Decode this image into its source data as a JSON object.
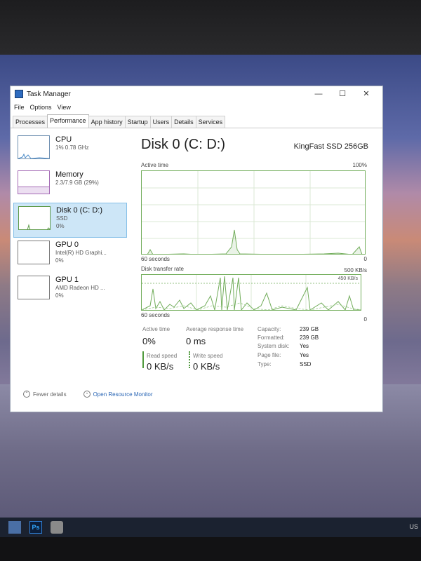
{
  "window": {
    "title": "Task Manager",
    "controls": {
      "minimize": "—",
      "maximize": "☐",
      "close": "✕"
    }
  },
  "menu": [
    "File",
    "Options",
    "View"
  ],
  "tabs": [
    "Processes",
    "Performance",
    "App history",
    "Startup",
    "Users",
    "Details",
    "Services"
  ],
  "active_tab": "Performance",
  "devices": [
    {
      "name": "CPU",
      "sub1": "1% 0.78 GHz",
      "sub2": ""
    },
    {
      "name": "Memory",
      "sub1": "2.3/7.9 GB (29%)",
      "sub2": ""
    },
    {
      "name": "Disk 0 (C: D:)",
      "sub1": "SSD",
      "sub2": "0%"
    },
    {
      "name": "GPU 0",
      "sub1": "Intel(R) HD Graphi...",
      "sub2": "0%"
    },
    {
      "name": "GPU 1",
      "sub1": "AMD Radeon HD ...",
      "sub2": "0%"
    }
  ],
  "selected_device": "Disk 0 (C: D:)",
  "detail": {
    "title": "Disk 0 (C: D:)",
    "model": "KingFast SSD 256GB",
    "graph1": {
      "label": "Active time",
      "max_label": "100%",
      "time_label": "60 seconds",
      "min_label": "0"
    },
    "graph2": {
      "label": "Disk transfer rate",
      "max_label": "500 KB/s",
      "ref_label": "450 KB/s",
      "time_label": "60 seconds",
      "min_label": "0"
    }
  },
  "stats": {
    "active_time_label": "Active time",
    "active_time_value": "0%",
    "avg_response_label": "Average response time",
    "avg_response_value": "0 ms",
    "read_speed_label": "Read speed",
    "read_speed_value": "0 KB/s",
    "write_speed_label": "Write speed",
    "write_speed_value": "0 KB/s"
  },
  "properties": [
    {
      "label": "Capacity:",
      "value": "239 GB"
    },
    {
      "label": "Formatted:",
      "value": "239 GB"
    },
    {
      "label": "System disk:",
      "value": "Yes"
    },
    {
      "label": "Page file:",
      "value": "Yes"
    },
    {
      "label": "Type:",
      "value": "SSD"
    }
  ],
  "footer": {
    "fewer_details": "Fewer details",
    "open_resource_monitor": "Open Resource Monitor"
  },
  "taskbar": {
    "ps_label": "Ps",
    "tray_text": "US"
  },
  "colors": {
    "disk_graph": "#72ad5b",
    "selection": "#cde6f7",
    "link": "#2a66b5"
  }
}
